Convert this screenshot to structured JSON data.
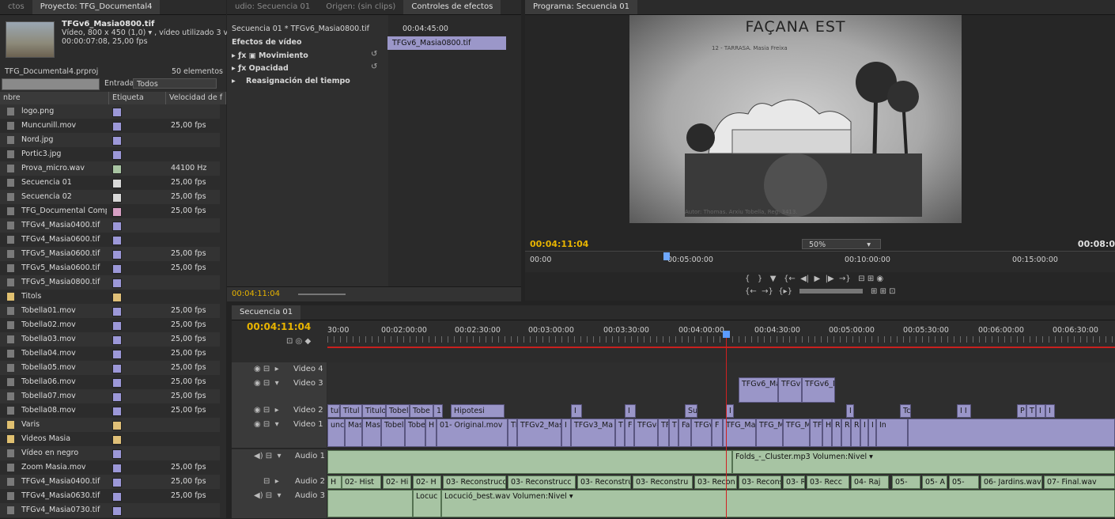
{
  "project": {
    "tabs": [
      "ctos",
      "Proyecto: TFG_Documental4"
    ],
    "clip_name": "TFGv6_Masia0800.tif",
    "clip_info1": "Vídeo, 800 x 450 (1,0) ▾ , vídeo utilizado 3 ve...",
    "clip_info2": "00:00:07:08, 25,00 fps",
    "file": "TFG_Documental4.prproj",
    "count": "50 elementos",
    "entrada_label": "Entrada:",
    "entrada_value": "Todos",
    "col_name": "nbre",
    "col_label": "Etiqueta",
    "col_speed": "Velocidad de f",
    "items": [
      {
        "name": "logo.png",
        "color": "#9c98d8",
        "speed": ""
      },
      {
        "name": "Muncunill.mov",
        "color": "#9c98d8",
        "speed": "25,00 fps"
      },
      {
        "name": "Nord.jpg",
        "color": "#9c98d8",
        "speed": ""
      },
      {
        "name": "Portic3.jpg",
        "color": "#9c98d8",
        "speed": ""
      },
      {
        "name": "Prova_micro.wav",
        "color": "#a8c4a2",
        "speed": "44100 Hz"
      },
      {
        "name": "Secuencia 01",
        "color": "#d8d8d8",
        "speed": "25,00 fps"
      },
      {
        "name": "Secuencia 02",
        "color": "#d8d8d8",
        "speed": "25,00 fps"
      },
      {
        "name": "TFG_Documental Comp v",
        "color": "#d7a0c4",
        "speed": "25,00 fps"
      },
      {
        "name": "TFGv4_Masia0400.tif",
        "color": "#9c98d8",
        "speed": ""
      },
      {
        "name": "TFGv4_Masia0600.tif",
        "color": "#9c98d8",
        "speed": ""
      },
      {
        "name": "TFGv5_Masia0600.tif",
        "color": "#9c98d8",
        "speed": "25,00 fps"
      },
      {
        "name": "TFGv5_Masia0600.tif",
        "color": "#9c98d8",
        "speed": "25,00 fps"
      },
      {
        "name": "TFGv5_Masia0800.tif",
        "color": "#9c98d8",
        "speed": ""
      },
      {
        "name": "Titols",
        "color": "#e0c078",
        "speed": ""
      },
      {
        "name": "Tobella01.mov",
        "color": "#9c98d8",
        "speed": "25,00 fps"
      },
      {
        "name": "Tobella02.mov",
        "color": "#9c98d8",
        "speed": "25,00 fps"
      },
      {
        "name": "Tobella03.mov",
        "color": "#9c98d8",
        "speed": "25,00 fps"
      },
      {
        "name": "Tobella04.mov",
        "color": "#9c98d8",
        "speed": "25,00 fps"
      },
      {
        "name": "Tobella05.mov",
        "color": "#9c98d8",
        "speed": "25,00 fps"
      },
      {
        "name": "Tobella06.mov",
        "color": "#9c98d8",
        "speed": "25,00 fps"
      },
      {
        "name": "Tobella07.mov",
        "color": "#9c98d8",
        "speed": "25,00 fps"
      },
      {
        "name": "Tobella08.mov",
        "color": "#9c98d8",
        "speed": "25,00 fps"
      },
      {
        "name": "Varis",
        "color": "#e0c078",
        "speed": ""
      },
      {
        "name": "Videos Masia",
        "color": "#e0c078",
        "speed": ""
      },
      {
        "name": "Vídeo en negro",
        "color": "#9c98d8",
        "speed": ""
      },
      {
        "name": "Zoom Masia.mov",
        "color": "#9c98d8",
        "speed": "25,00 fps"
      },
      {
        "name": "TFGv4_Masia0400.tif",
        "color": "#9c98d8",
        "speed": "25,00 fps"
      },
      {
        "name": "TFGv4_Masia0630.tif",
        "color": "#9c98d8",
        "speed": "25,00 fps"
      },
      {
        "name": "TFGv4_Masia0730.tif",
        "color": "#9c98d8",
        "speed": ""
      }
    ]
  },
  "effects": {
    "tabs": [
      "udio: Secuencia 01",
      "Origen: (sin clips)",
      "Controles de efectos"
    ],
    "seq_label": "Secuencia 01 * TFGv6_Masia0800.tif",
    "timecode": "00:04:45:00",
    "clip_bar": "TFGv6_Masia0800.tif",
    "section": "Efectos de vídeo",
    "movimiento": "Movimiento",
    "opacidad": "Opacidad",
    "reasign": "Reasignación del tiempo",
    "current_time": "00:04:11:04"
  },
  "program": {
    "tab": "Programa: Secuencia 01",
    "photo_title": "FAÇANA EST",
    "photo_caption": "12 - TARRASA. Masia Freixa",
    "photo_credit": "Autor: Thomas. Arxiu Tobella, Reg. 3413.",
    "timecode": "00:04:11:04",
    "zoom": "50%",
    "duration": "00:08:0",
    "ruler": [
      "00:00",
      "00:05:00:00",
      "00:10:00:00",
      "00:15:00:00"
    ]
  },
  "timeline": {
    "tab": "Secuencia 01",
    "timecode": "00:04:11:04",
    "ruler": [
      "30:00",
      "00:02:00:00",
      "00:02:30:00",
      "00:03:00:00",
      "00:03:30:00",
      "00:04:00:00",
      "00:04:30:00",
      "00:05:00:00",
      "00:05:30:00",
      "00:06:00:00",
      "00:06:30:00"
    ],
    "tracks": {
      "v4": "Video 4",
      "v3": "Video 3",
      "v2": "Video 2",
      "v1": "Video 1",
      "a1": "Audio 1",
      "a2": "Audio 2",
      "a3": "Audio 3"
    },
    "v3_clips": [
      "TFGv6_Mas",
      "TFGv6",
      "TFGv6_M"
    ],
    "v2_clips": [
      "tul",
      "Titul",
      "Titulo",
      "Tobel",
      "Tobe",
      "1",
      "Hipotesi",
      "I",
      "I",
      "Su",
      "I",
      "I",
      "Tc",
      "I I",
      "P",
      "T",
      "I",
      "I"
    ],
    "v1_clips": [
      "unc",
      "Mas",
      "Masi",
      "Tobel",
      "Tobe",
      "H",
      "01- Original.mov",
      "TFG",
      "TFGv2_Masi",
      "I",
      "TFGv3_Ma",
      "T",
      "F",
      "TFGv4",
      "TF",
      "T",
      "Fa",
      "TFGv",
      "F",
      "TFG_Masia",
      "TFG_M",
      "TFG_Ma",
      "TF",
      "H",
      "R",
      "R",
      "R",
      "I",
      "I",
      "In"
    ],
    "a1_clip": "Folds_-_Cluster.mp3",
    "a1_vol": "Volumen:Nivel ▾",
    "a2_clips": [
      "H",
      "02- Hist",
      "02- Hi",
      "02- H",
      "03- Reconstruccio.w",
      "03- Reconstrucc",
      "03- Reconstruc",
      "03- Reconstru",
      "03- Recon",
      "03- Recons",
      "03- R",
      "03- Recc",
      "04- Raj",
      "05-",
      "05- A",
      "05-",
      "06- Jardins.wav",
      "07- Final.wav"
    ],
    "a3_clips": [
      "Locuc",
      "Locució_best.wav"
    ],
    "a3_vol": "Volumen:Nivel ▾"
  }
}
